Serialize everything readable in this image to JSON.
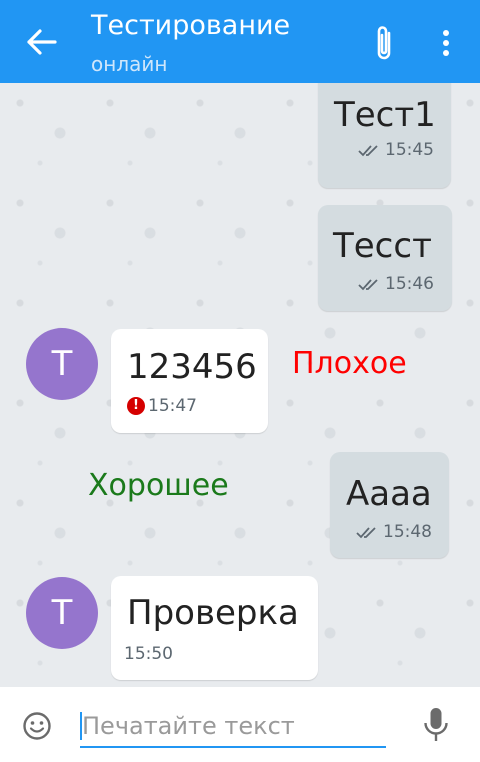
{
  "header": {
    "title": "Тестирование",
    "status": "онлайн",
    "back_icon": "arrow-left-icon",
    "attach_icon": "paperclip-icon",
    "menu_icon": "more-vert-icon"
  },
  "messages": [
    {
      "direction": "out",
      "text": "Тест1",
      "time": "15:45",
      "status": "read"
    },
    {
      "direction": "out",
      "text": "Тесст",
      "time": "15:46",
      "status": "read"
    },
    {
      "direction": "in",
      "avatar_letter": "Т",
      "text": "123456",
      "time": "15:47",
      "status": "error"
    },
    {
      "direction": "out",
      "text": "Аааа",
      "time": "15:48",
      "status": "read"
    },
    {
      "direction": "in",
      "avatar_letter": "Т",
      "text": "Проверка",
      "time": "15:50"
    }
  ],
  "annotations": {
    "bad": {
      "text": "Плохое",
      "color": "#ff0000"
    },
    "good": {
      "text": "Хорошее",
      "color": "#1b7a1b"
    }
  },
  "composer": {
    "placeholder": "Печатайте текст",
    "emoji_icon": "smiley-icon",
    "mic_icon": "microphone-icon"
  },
  "colors": {
    "accent": "#2196f3",
    "avatar": "#9575cd",
    "error": "#d50000"
  }
}
